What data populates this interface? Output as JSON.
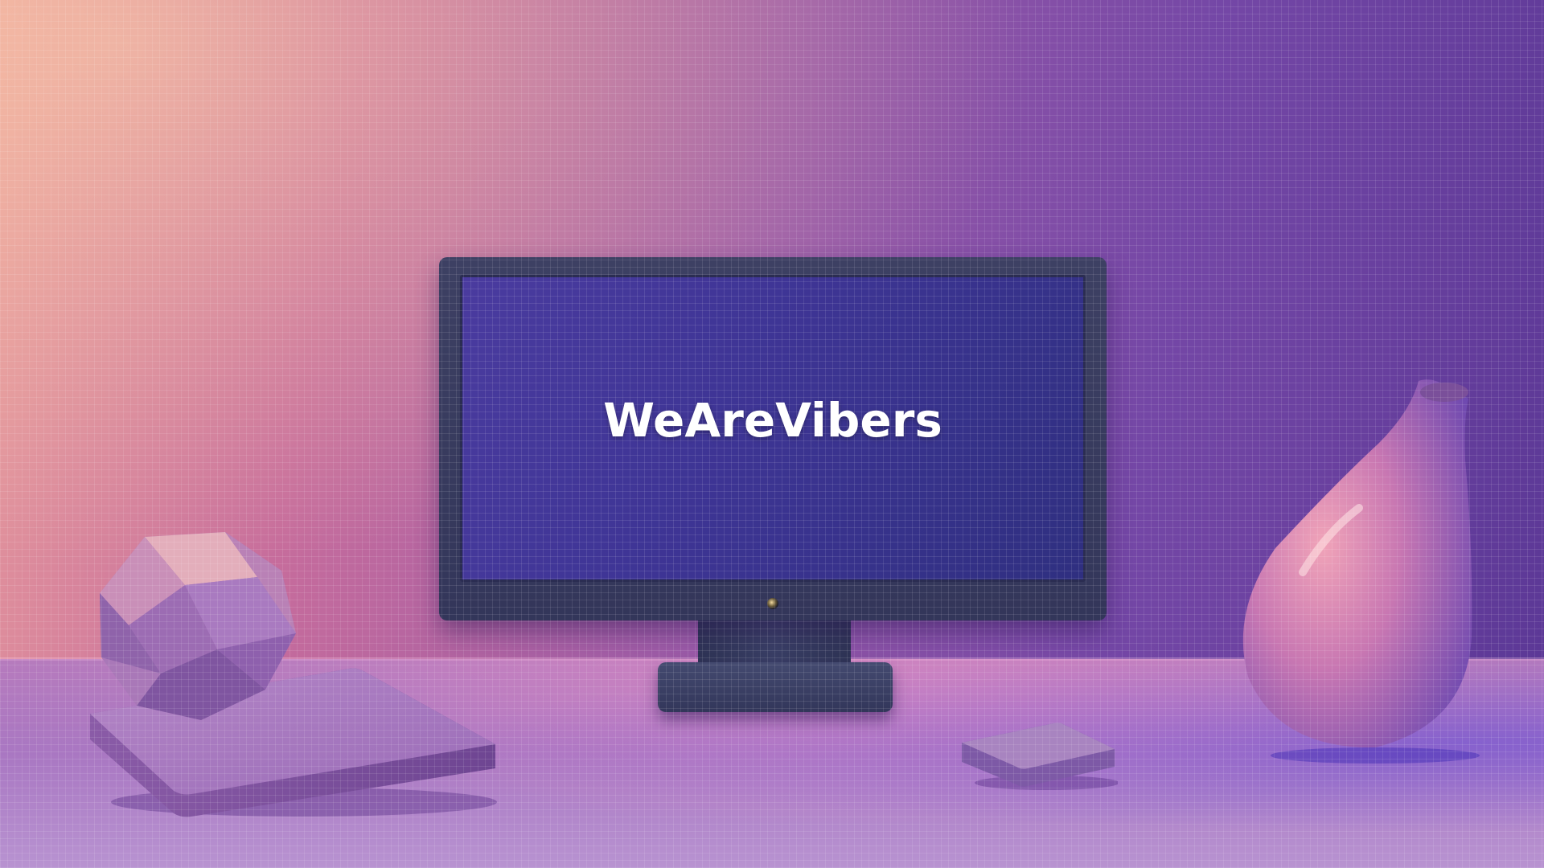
{
  "screen": {
    "brand_text": "WeAreVibers"
  },
  "scene": {
    "objects": [
      "monitor",
      "geometric-gem",
      "square-platform",
      "small-block",
      "droplet-vase"
    ],
    "colors": {
      "wall_left": "#e79a9c",
      "wall_right": "#5a3795",
      "screen": "#3f3596",
      "bezel": "#3d4063"
    }
  }
}
